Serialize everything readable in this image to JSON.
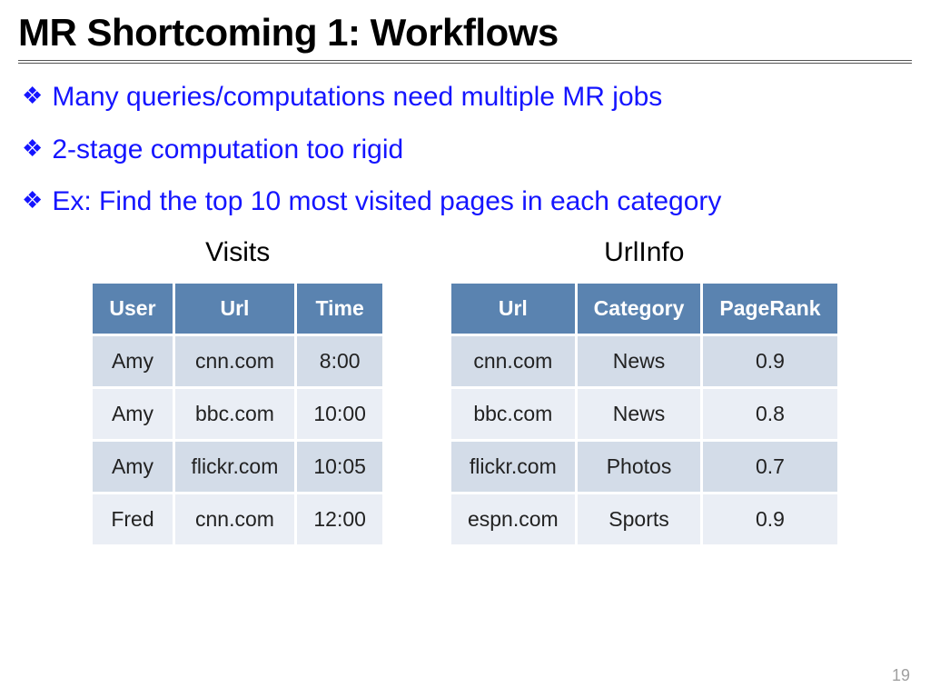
{
  "title": "MR Shortcoming 1: Workflows",
  "bullets": [
    "Many queries/computations need multiple MR jobs",
    "2-stage computation too rigid",
    "Ex: Find the top 10 most visited pages in each category"
  ],
  "tables": {
    "visits": {
      "caption": "Visits",
      "headers": [
        "User",
        "Url",
        "Time"
      ],
      "rows": [
        [
          "Amy",
          "cnn.com",
          "8:00"
        ],
        [
          "Amy",
          "bbc.com",
          "10:00"
        ],
        [
          "Amy",
          "flickr.com",
          "10:05"
        ],
        [
          "Fred",
          "cnn.com",
          "12:00"
        ]
      ]
    },
    "urlinfo": {
      "caption": "UrlInfo",
      "headers": [
        "Url",
        "Category",
        "PageRank"
      ],
      "rows": [
        [
          "cnn.com",
          "News",
          "0.9"
        ],
        [
          "bbc.com",
          "News",
          "0.8"
        ],
        [
          "flickr.com",
          "Photos",
          "0.7"
        ],
        [
          "espn.com",
          "Sports",
          "0.9"
        ]
      ]
    }
  },
  "page_number": "19"
}
